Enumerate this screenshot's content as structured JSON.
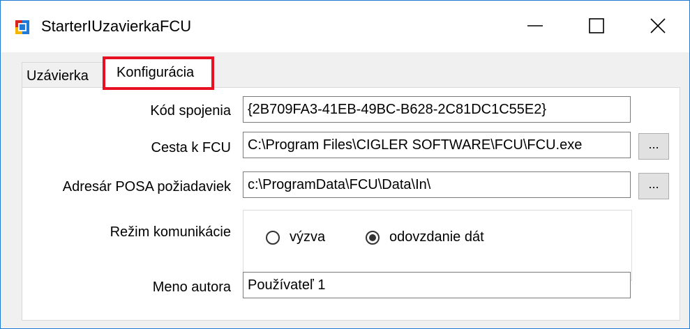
{
  "window": {
    "title": "StarterIUzavierkaFCU",
    "controls": {
      "minimize_icon": "minimize-icon",
      "maximize_icon": "maximize-icon",
      "close_icon": "close-icon"
    }
  },
  "tabs": [
    {
      "label": "Uzávierka",
      "active": false
    },
    {
      "label": "Konfigurácia",
      "active": true
    }
  ],
  "form": {
    "connection_code": {
      "label": "Kód spojenia",
      "value": "{2B709FA3-41EB-49BC-B628-2C81DC1C55E2}"
    },
    "fcu_path": {
      "label": "Cesta k FCU",
      "value": "C:\\Program Files\\CIGLER SOFTWARE\\FCU\\FCU.exe",
      "browse_label": "..."
    },
    "posa_dir": {
      "label": "Adresár POSA požiadaviek",
      "value": "c:\\ProgramData\\FCU\\Data\\In\\",
      "browse_label": "..."
    },
    "comm_mode": {
      "label": "Režim komunikácie",
      "options": [
        {
          "label": "výzva",
          "selected": false
        },
        {
          "label": "odovzdanie dát",
          "selected": true
        }
      ]
    },
    "author": {
      "label": "Meno autora",
      "value": "Používateľ 1"
    }
  },
  "colors": {
    "highlight_border": "#e81123",
    "window_border": "#1e7ad4"
  }
}
